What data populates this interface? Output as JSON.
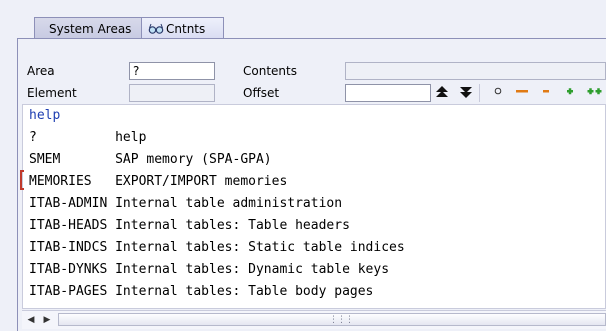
{
  "tabs": [
    {
      "label": "System Areas",
      "active": false
    },
    {
      "label": "Cntnts",
      "active": true,
      "icon": "glasses-icon"
    }
  ],
  "form": {
    "area_label": "Area",
    "area_value": "?",
    "element_label": "Element",
    "element_value": "",
    "contents_label": "Contents",
    "contents_value": "",
    "offset_label": "Offset",
    "offset_value": ""
  },
  "toolbar": {
    "icons": [
      "page-top-icon",
      "page-bottom-icon",
      "circle-icon",
      "long-minus-icon",
      "minus-icon",
      "plus-icon",
      "double-plus-icon"
    ]
  },
  "output": {
    "header": "help",
    "lines": [
      "?          help",
      "SMEM       SAP memory (SPA-GPA)",
      "MEMORIES   EXPORT/IMPORT memories",
      "ITAB-ADMIN Internal table administration",
      "ITAB-HEADS Internal tables: Table headers",
      "ITAB-INDCS Internal tables: Static table indices",
      "ITAB-DYNKS Internal tables: Dynamic table keys",
      "ITAB-PAGES Internal tables: Table body pages"
    ]
  },
  "colors": {
    "header_text": "#1f3fb2",
    "plus": "#2e9e2e",
    "minus": "#e07a14",
    "marker": "#c0392b"
  }
}
